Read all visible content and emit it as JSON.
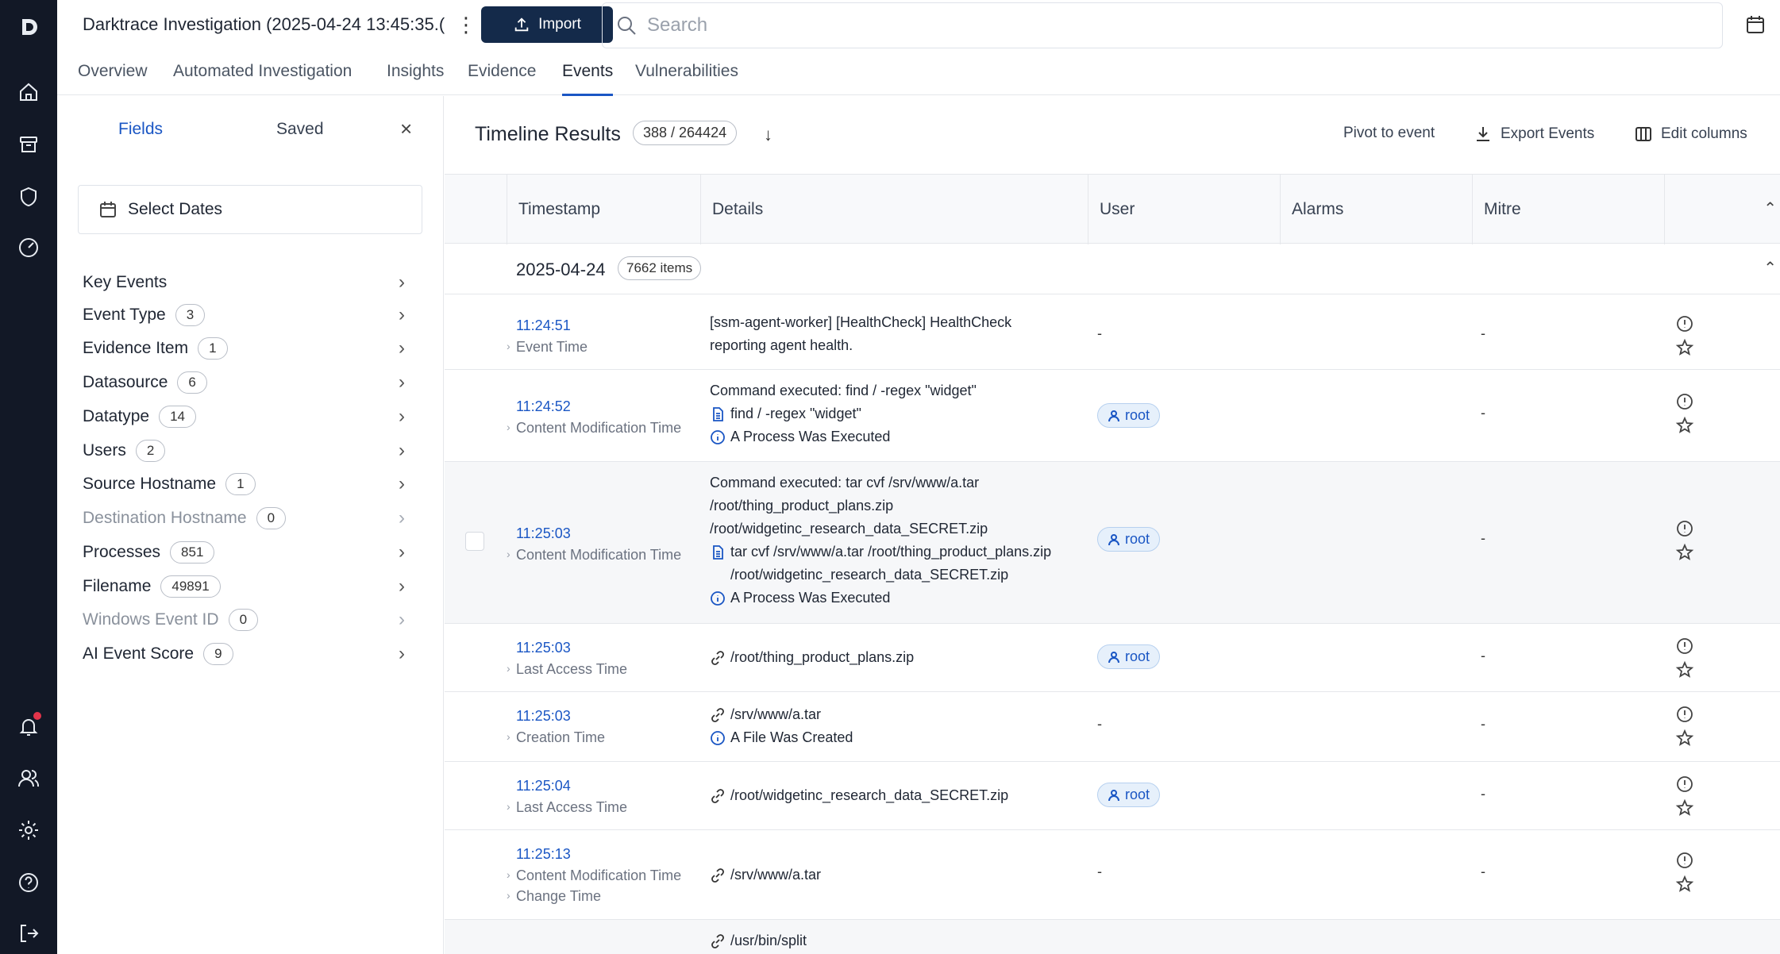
{
  "header": {
    "case_title": "Darktrace Investigation (2025-04-24 13:45:35.(",
    "import_label": "Import",
    "search_placeholder": "Search"
  },
  "tabs": [
    {
      "label": "Overview"
    },
    {
      "label": "Automated Investigation"
    },
    {
      "label": "Insights"
    },
    {
      "label": "Evidence"
    },
    {
      "label": "Events",
      "active": true
    },
    {
      "label": "Vulnerabilities"
    }
  ],
  "panel": {
    "tab_fields": "Fields",
    "tab_saved": "Saved",
    "close": "×",
    "select_dates": "Select Dates",
    "fields": [
      {
        "label": "Key Events",
        "count": null
      },
      {
        "label": "Event Type",
        "count": "3"
      },
      {
        "label": "Evidence Item",
        "count": "1"
      },
      {
        "label": "Datasource",
        "count": "6"
      },
      {
        "label": "Datatype",
        "count": "14"
      },
      {
        "label": "Users",
        "count": "2"
      },
      {
        "label": "Source Hostname",
        "count": "1"
      },
      {
        "label": "Destination Hostname",
        "count": "0",
        "muted": true
      },
      {
        "label": "Processes",
        "count": "851"
      },
      {
        "label": "Filename",
        "count": "49891"
      },
      {
        "label": "Windows Event ID",
        "count": "0",
        "muted": true
      },
      {
        "label": "AI Event Score",
        "count": "9"
      }
    ]
  },
  "timeline": {
    "title": "Timeline Results",
    "count": "388 / 264424",
    "sort_icon": "arrow-down-icon",
    "pivot_label": "Pivot to event",
    "export_label": "Export Events",
    "edit_columns_label": "Edit columns",
    "columns": [
      "Timestamp",
      "Details",
      "User",
      "Alarms",
      "Mitre"
    ],
    "date_group": {
      "date": "2025-04-24",
      "count": "7662 items"
    },
    "rows": [
      {
        "time": "11:24:51",
        "types": [
          "Event Time"
        ],
        "details": [
          {
            "icon": null,
            "text": "[ssm-agent-worker] [HealthCheck] HealthCheck"
          },
          {
            "icon": null,
            "text": "reporting agent health."
          }
        ],
        "user": "-",
        "alarms": "",
        "mitre": "-"
      },
      {
        "time": "11:24:52",
        "types": [
          "Content Modification Time"
        ],
        "details": [
          {
            "icon": null,
            "text": "Command executed: find / -regex \"widget\""
          },
          {
            "icon": "file-icon",
            "text": "find / -regex \"widget\""
          },
          {
            "icon": "info-icon",
            "text": "A Process Was Executed"
          }
        ],
        "user": "root",
        "alarms": "",
        "mitre": "-"
      },
      {
        "time": "11:25:03",
        "types": [
          "Content Modification Time"
        ],
        "details": [
          {
            "icon": null,
            "text": "Command executed: tar cvf /srv/www/a.tar"
          },
          {
            "icon": null,
            "text": "/root/thing_product_plans.zip"
          },
          {
            "icon": null,
            "text": "/root/widgetinc_research_data_SECRET.zip"
          },
          {
            "icon": "file-icon",
            "text": "tar cvf /srv/www/a.tar /root/thing_product_plans.zip"
          },
          {
            "icon": "indent",
            "text": "/root/widgetinc_research_data_SECRET.zip"
          },
          {
            "icon": "info-icon",
            "text": "A Process Was Executed"
          }
        ],
        "user": "root",
        "alarms": "",
        "mitre": "-"
      },
      {
        "time": "11:25:03",
        "types": [
          "Last Access Time"
        ],
        "details": [
          {
            "icon": "link-icon",
            "text": "/root/thing_product_plans.zip"
          }
        ],
        "user": "root",
        "alarms": "",
        "mitre": "-"
      },
      {
        "time": "11:25:03",
        "types": [
          "Creation Time"
        ],
        "details": [
          {
            "icon": "link-icon",
            "text": "/srv/www/a.tar"
          },
          {
            "icon": "info-icon",
            "text": "A File Was Created"
          }
        ],
        "user": "-",
        "alarms": "",
        "mitre": "-"
      },
      {
        "time": "11:25:04",
        "types": [
          "Last Access Time"
        ],
        "details": [
          {
            "icon": "link-icon",
            "text": "/root/widgetinc_research_data_SECRET.zip"
          }
        ],
        "user": "root",
        "alarms": "",
        "mitre": "-"
      },
      {
        "time": "11:25:13",
        "types": [
          "Content Modification Time",
          "Change Time"
        ],
        "details": [
          {
            "icon": "link-icon",
            "text": "/srv/www/a.tar"
          }
        ],
        "user": "-",
        "alarms": "",
        "mitre": "-"
      },
      {
        "time": "",
        "types": [],
        "details": [
          {
            "icon": "link-icon",
            "text": "/usr/bin/split"
          }
        ],
        "user": "",
        "alarms": "",
        "mitre": ""
      }
    ]
  }
}
